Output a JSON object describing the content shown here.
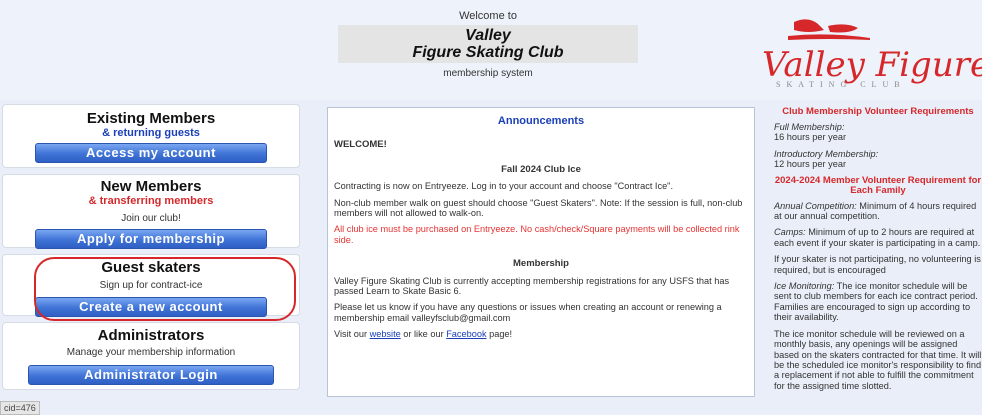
{
  "header": {
    "welcome_to": "Welcome to",
    "club_line1": "Valley",
    "club_line2": "Figure Skating Club",
    "subtitle": "membership system"
  },
  "logo": {
    "script_text": "Valley Figure",
    "sub_text": "SKATING CLUB",
    "color": "#d6282b"
  },
  "panels": {
    "existing": {
      "title": "Existing Members",
      "link": "& returning guests",
      "button": "Access my account"
    },
    "new": {
      "title": "New Members",
      "link": "& transferring members",
      "sub": "Join our club!",
      "button": "Apply for membership"
    },
    "guest": {
      "title": "Guest skaters",
      "sub": "Sign up for contract-ice",
      "button": "Create a new account"
    },
    "admin": {
      "title": "Administrators",
      "sub": "Manage your membership information",
      "button": "Administrator Login"
    }
  },
  "announcements": {
    "title": "Announcements",
    "welcome": "WELCOME!",
    "h1": "Fall 2024 Club Ice",
    "p1": "Contracting is now on Entryeeze. Log in to your account and choose \"Contract Ice\".",
    "p2": "Non-club member walk on guest should choose \"Guest Skaters\". Note: If the session is full, non-club members will not allowed to walk-on.",
    "p3": "All club ice must be purchased on Entryeeze. No cash/check/Square payments will be collected rink side.",
    "h2": "Membership",
    "p4": "Valley Figure Skating Club is currently accepting membership registrations for any USFS that has passed Learn to Skate Basic 6.",
    "p5": "Please let us know if you have any questions or issues when creating an account or renewing a membership email valleyfsclub@gmail.com",
    "p6_pre": "Visit our ",
    "p6_link1": "website",
    "p6_mid": " or like our ",
    "p6_link2": "Facebook",
    "p6_post": " page!"
  },
  "right": {
    "h1": "Club Membership Volunteer Requirements",
    "full_label": "Full Membership:",
    "full_value": "16 hours per year",
    "intro_label": "Introductory Membership:",
    "intro_value": "12 hours per year",
    "h2": "2024-2024 Member Volunteer Requirement for Each Family",
    "annual_label": "Annual Competition:",
    "annual_text": " Minimum of 4 hours required at our annual competition.",
    "camps_label": "Camps:",
    "camps_text": " Minimum of up to 2 hours are required at each event if your skater is participating in a camp.",
    "not_participating": "If your skater is not participating, no volunteering is required, but is encouraged",
    "ice_label": "Ice Monitoring:",
    "ice_text": " The ice monitor schedule will be sent to club members for each ice contract period. Families are encouraged to sign up according to their availability.",
    "schedule_text": "The ice monitor schedule will be reviewed on a monthly basis, any openings will be assigned based on the skaters contracted for that time. It will be the scheduled ice monitor's responsibility to find a replacement if not able to fulfill the commitment for the assigned time slotted."
  },
  "status_bar": "cid=476"
}
